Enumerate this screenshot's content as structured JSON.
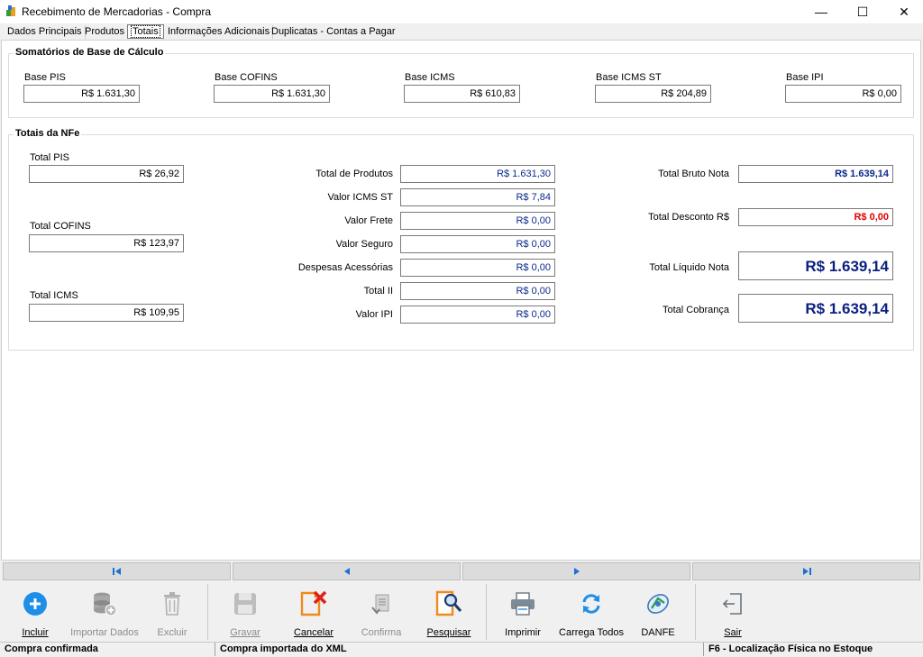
{
  "window": {
    "title": "Recebimento de Mercadorias - Compra",
    "minimize": "—",
    "maximize": "☐",
    "close": "✕"
  },
  "tabs": [
    {
      "label": "Dados Principais"
    },
    {
      "label": "Produtos"
    },
    {
      "label": "Totais"
    },
    {
      "label": "Informações Adicionais"
    },
    {
      "label": "Duplicatas - Contas a Pagar"
    }
  ],
  "bases": {
    "title": "Somatórios de Base de Cálculo",
    "pis": {
      "label": "Base PIS",
      "value": "R$ 1.631,30"
    },
    "cofins": {
      "label": "Base COFINS",
      "value": "R$ 1.631,30"
    },
    "icms": {
      "label": "Base ICMS",
      "value": "R$ 610,83"
    },
    "icms_st": {
      "label": "Base ICMS ST",
      "value": "R$ 204,89"
    },
    "ipi": {
      "label": "Base IPI",
      "value": "R$ 0,00"
    }
  },
  "totais": {
    "title": "Totais da NFe",
    "total_pis": {
      "label": "Total PIS",
      "value": "R$ 26,92"
    },
    "total_cofins": {
      "label": "Total COFINS",
      "value": "R$ 123,97"
    },
    "total_icms": {
      "label": "Total ICMS",
      "value": "R$ 109,95"
    },
    "total_produtos": {
      "label": "Total de Produtos",
      "value": "R$ 1.631,30"
    },
    "valor_icms_st": {
      "label": "Valor ICMS ST",
      "value": "R$ 7,84"
    },
    "valor_frete": {
      "label": "Valor Frete",
      "value": "R$ 0,00"
    },
    "valor_seguro": {
      "label": "Valor Seguro",
      "value": "R$ 0,00"
    },
    "despesas": {
      "label": "Despesas Acessórias",
      "value": "R$ 0,00"
    },
    "total_ii": {
      "label": "Total II",
      "value": "R$ 0,00"
    },
    "valor_ipi": {
      "label": "Valor IPI",
      "value": "R$ 0,00"
    },
    "total_bruto": {
      "label": "Total Bruto Nota",
      "value": "R$ 1.639,14"
    },
    "total_desconto": {
      "label": "Total Desconto R$",
      "value": "R$ 0,00"
    },
    "total_liquido": {
      "label": "Total Líquido Nota",
      "value": "R$ 1.639,14"
    },
    "total_cobranca": {
      "label": "Total Cobrança",
      "value": "R$ 1.639,14"
    }
  },
  "toolbar": {
    "incluir": "Incluir",
    "importar": "Importar Dados",
    "excluir": "Excluir",
    "gravar": "Gravar",
    "cancelar": "Cancelar",
    "confirma": "Confirma",
    "pesquisar": "Pesquisar",
    "imprimir": "Imprimir",
    "carrega": "Carrega Todos",
    "danfe": "DANFE",
    "sair": "Sair"
  },
  "status": {
    "left": "Compra confirmada",
    "middle": "Compra importada do XML",
    "right": "F6 - Localização Física no Estoque"
  },
  "colors": {
    "value_blue": "#0b2a8a",
    "discount_red": "#e00000",
    "nav_arrow": "#1a6fd6"
  }
}
